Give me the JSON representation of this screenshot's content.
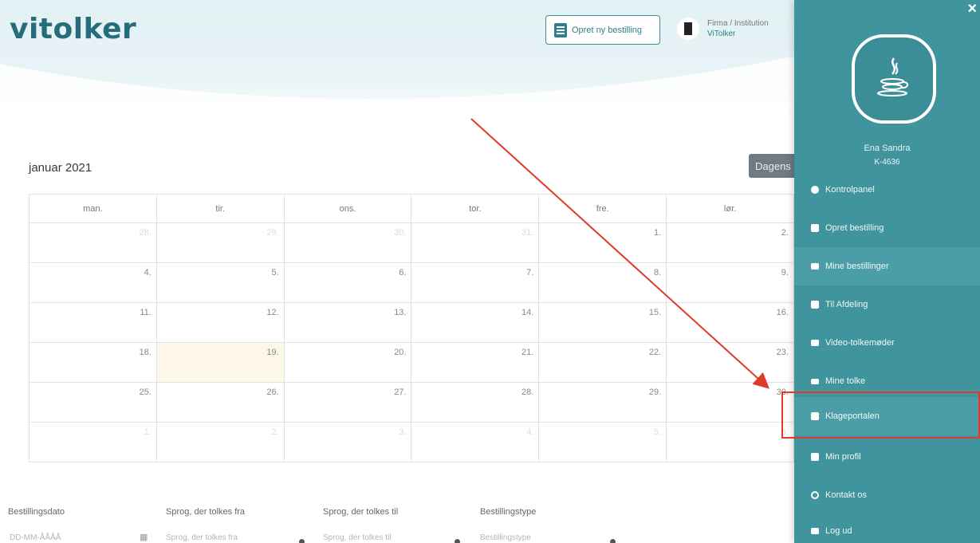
{
  "header": {
    "logo": "vitolker",
    "new_order_label": "Opret ny bestilling",
    "firm_label": "Firma / Institution",
    "firm_name": "ViTolker"
  },
  "calendar": {
    "title": "januar 2021",
    "today_label": "Dagens",
    "weekdays": [
      "man.",
      "tir.",
      "ons.",
      "tor.",
      "fre.",
      "lør."
    ],
    "rows": [
      [
        "28.",
        "29.",
        "30.",
        "31.",
        "1.",
        "2."
      ],
      [
        "4.",
        "5.",
        "6.",
        "7.",
        "8.",
        "9."
      ],
      [
        "11.",
        "12.",
        "13.",
        "14.",
        "15.",
        "16."
      ],
      [
        "18.",
        "19.",
        "20.",
        "21.",
        "22.",
        "23."
      ],
      [
        "25.",
        "26.",
        "27.",
        "28.",
        "29.",
        "30."
      ],
      [
        "1.",
        "2.",
        "3.",
        "4.",
        "5.",
        "6."
      ]
    ]
  },
  "filters": {
    "date_label": "Bestillingsdato",
    "date_placeholder": "DD-MM-ÅÅÅÅ",
    "lang_from_label": "Sprog, der tolkes fra",
    "lang_from_placeholder": "Sprog, der tolkes fra",
    "lang_to_label": "Sprog, der tolkes til",
    "lang_to_placeholder": "Sprog, der tolkes til",
    "type_label": "Bestillingstype",
    "type_placeholder": "Bestillingstype"
  },
  "sidebar": {
    "close": "×",
    "user_name": "Ena Sandra",
    "user_id": "K-4636",
    "items": [
      {
        "label": "Kontrolpanel",
        "icon": "pie-chart-icon"
      },
      {
        "label": "Opret bestilling",
        "icon": "document-icon"
      },
      {
        "label": "Mine bestillinger",
        "icon": "list-icon"
      },
      {
        "label": "Til Afdeling",
        "icon": "user-icon"
      },
      {
        "label": "Video-tolkemøder",
        "icon": "video-icon"
      },
      {
        "label": "Mine tolke",
        "icon": "id-card-icon"
      },
      {
        "label": "Klageportalen",
        "icon": "gate-icon"
      },
      {
        "label": "Min profil",
        "icon": "profile-icon"
      },
      {
        "label": "Kontakt os",
        "icon": "headset-icon"
      },
      {
        "label": "Log ud",
        "icon": "logout-icon"
      }
    ]
  },
  "colors": {
    "sidebar": "#40949d",
    "accent": "#2f7f8c",
    "annotation": "#e03a2a",
    "today_highlight": "#fcf7e6"
  }
}
